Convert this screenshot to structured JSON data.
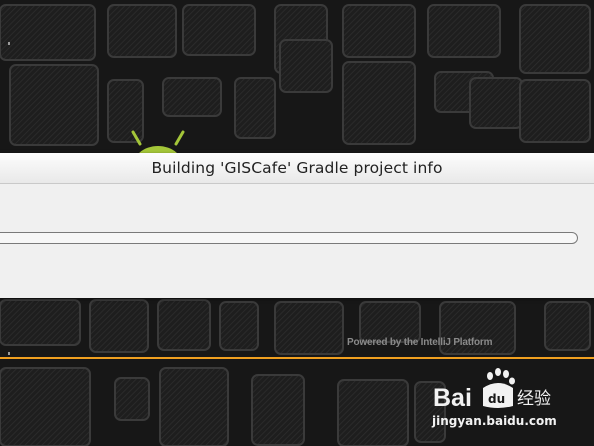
{
  "dialog": {
    "title": "Building 'GISCafe' Gradle project info",
    "progress_indeterminate": true
  },
  "splash": {
    "powered_by": "Powered by the IntelliJ Platform",
    "accent_color": "#f0a020",
    "logo_icon": "android-robot-icon"
  },
  "watermark": {
    "brand_latin": "Bai",
    "brand_chinese": "经验",
    "url": "jingyan.baidu.com",
    "icon": "baidu-paw-icon"
  }
}
